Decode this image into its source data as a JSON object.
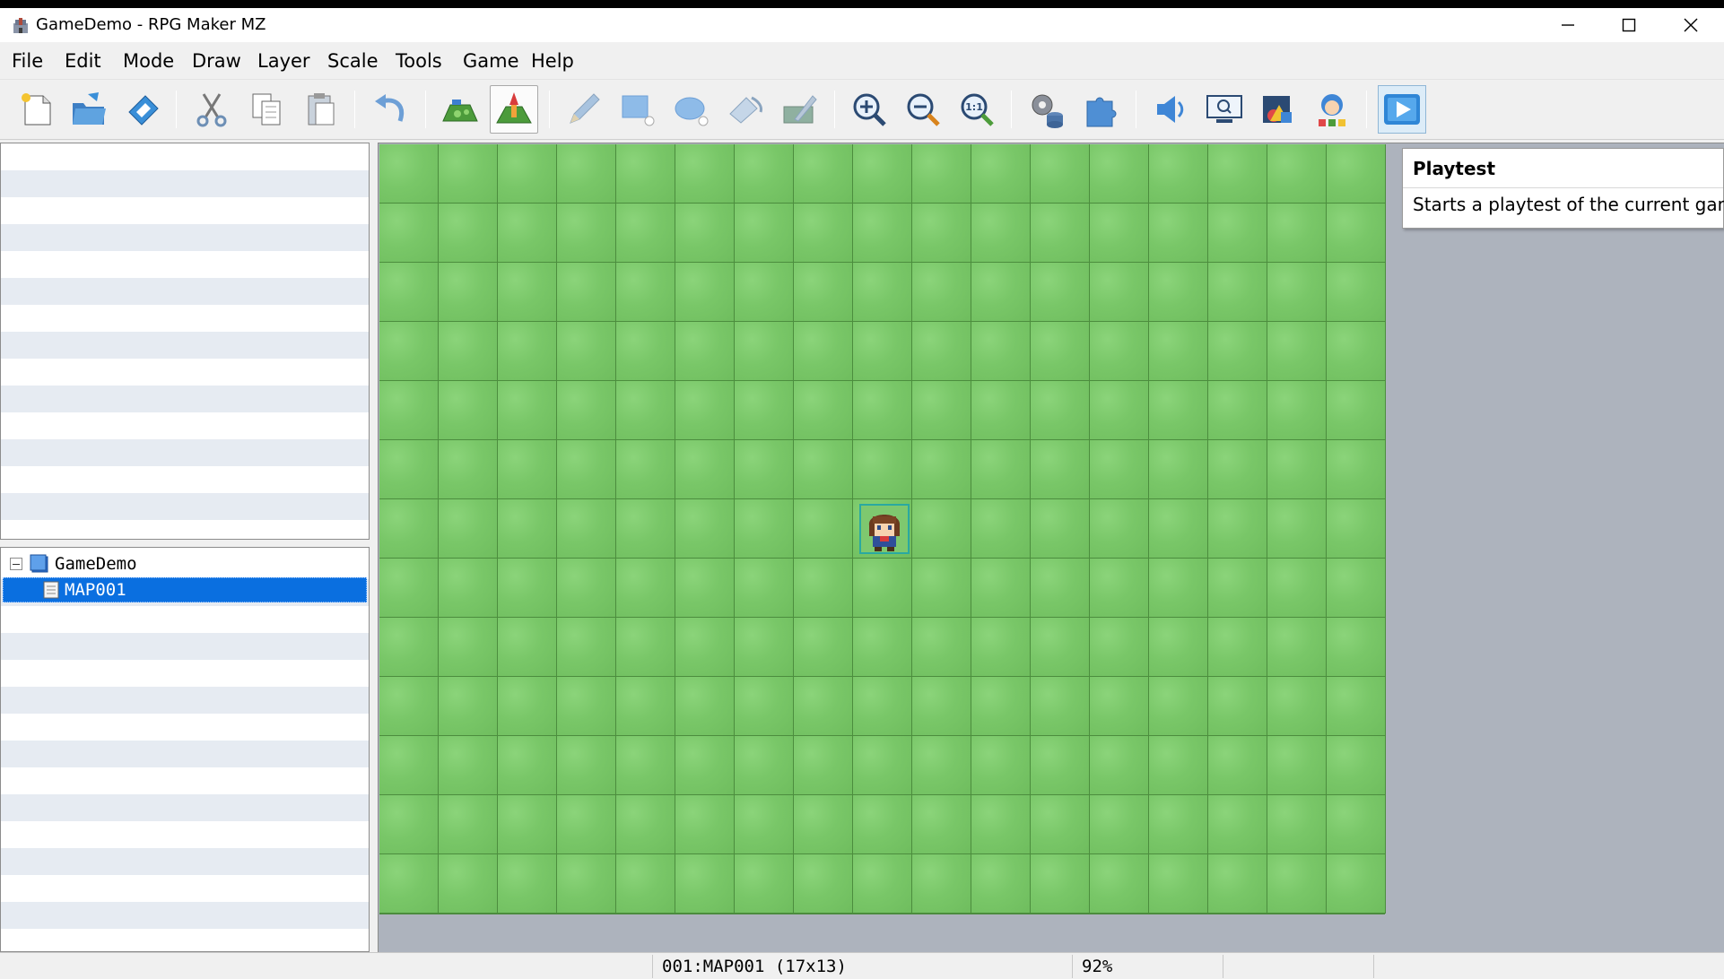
{
  "window": {
    "title": "GameDemo - RPG Maker MZ",
    "app_icon": "rpg-maker-castle-icon",
    "controls": [
      "minimize-icon",
      "maximize-icon",
      "close-icon"
    ]
  },
  "menu": {
    "items": [
      "File",
      "Edit",
      "Mode",
      "Draw",
      "Layer",
      "Scale",
      "Tools",
      "Game",
      "Help"
    ]
  },
  "toolbar": {
    "buttons": [
      {
        "name": "new-project",
        "icon": "new-project-icon"
      },
      {
        "name": "open-project",
        "icon": "open-folder-icon"
      },
      {
        "name": "save-project",
        "icon": "save-disk-icon"
      },
      {
        "name": "cut",
        "icon": "scissors-icon"
      },
      {
        "name": "copy",
        "icon": "copy-icon"
      },
      {
        "name": "paste",
        "icon": "paste-icon"
      },
      {
        "name": "undo",
        "icon": "undo-arrow-icon"
      },
      {
        "name": "map-mode",
        "icon": "map-mode-icon"
      },
      {
        "name": "event-mode",
        "icon": "event-mode-icon",
        "active": true
      },
      {
        "name": "pencil",
        "icon": "pencil-icon"
      },
      {
        "name": "rectangle",
        "icon": "rectangle-icon"
      },
      {
        "name": "ellipse",
        "icon": "ellipse-icon"
      },
      {
        "name": "flood-fill",
        "icon": "fill-icon"
      },
      {
        "name": "shadow-pen",
        "icon": "shadow-pen-icon"
      },
      {
        "name": "zoom-in",
        "icon": "zoom-in-icon"
      },
      {
        "name": "zoom-out",
        "icon": "zoom-out-icon"
      },
      {
        "name": "actual-size",
        "icon": "zoom-1to1-icon"
      },
      {
        "name": "database",
        "icon": "database-gear-icon"
      },
      {
        "name": "plugin-manager",
        "icon": "puzzle-icon"
      },
      {
        "name": "sound-test",
        "icon": "speaker-icon"
      },
      {
        "name": "event-searcher",
        "icon": "monitor-search-icon"
      },
      {
        "name": "resource-manager",
        "icon": "resource-icon"
      },
      {
        "name": "character-generator",
        "icon": "character-generator-icon"
      },
      {
        "name": "playtest",
        "icon": "play-icon"
      }
    ]
  },
  "map_tree": {
    "root": "GameDemo",
    "maps": [
      {
        "label": "MAP001",
        "selected": true
      }
    ]
  },
  "map": {
    "columns": 17,
    "rows": 13,
    "tile": "grass",
    "event": {
      "type": "player-start",
      "col": 8,
      "row": 6
    }
  },
  "tooltip": {
    "title": "Playtest",
    "body": "Starts a playtest of the current game."
  },
  "status": {
    "map_info": "001:MAP001 (17x13)",
    "zoom": "92%"
  },
  "colors": {
    "selection": "#0a6fe0",
    "grass": "#79c768",
    "canvas_bg": "#adb3bd"
  }
}
